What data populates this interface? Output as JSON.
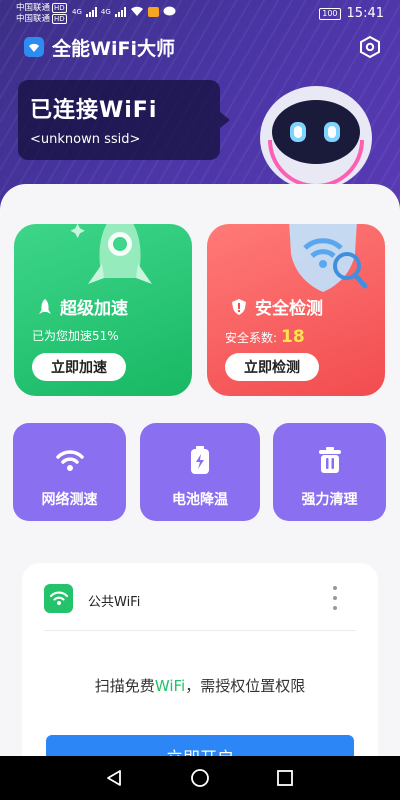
{
  "status_bar": {
    "carrier_1": "中国联通",
    "carrier_2": "中国联通",
    "hd": "HD",
    "network_1": "4G",
    "network_2": "4G",
    "battery": "100",
    "time": "15:41"
  },
  "app": {
    "title": "全能WiFi大师"
  },
  "connection": {
    "status": "已连接WiFi",
    "ssid": "<unknown ssid>"
  },
  "tiles": {
    "speedup": {
      "title": "超级加速",
      "subtitle": "已为您加速51%",
      "button": "立即加速",
      "color": "#22c36a"
    },
    "security": {
      "title": "安全检测",
      "subtitle_label": "安全系数:",
      "score": "18",
      "button": "立即检测",
      "color": "#f45556"
    }
  },
  "tools": [
    {
      "label": "网络测速",
      "icon": "wifi-icon"
    },
    {
      "label": "电池降温",
      "icon": "battery-icon"
    },
    {
      "label": "强力清理",
      "icon": "trash-icon"
    }
  ],
  "wifi_card": {
    "network_name": "公共WiFi",
    "scan_prefix": "扫描免费",
    "scan_highlight": "WiFi",
    "scan_suffix": "，需授权位置权限",
    "button": "立即开启"
  },
  "colors": {
    "header": "#4a35a5",
    "tool_tile": "#8a6ff0",
    "primary_button": "#2c86f5"
  }
}
